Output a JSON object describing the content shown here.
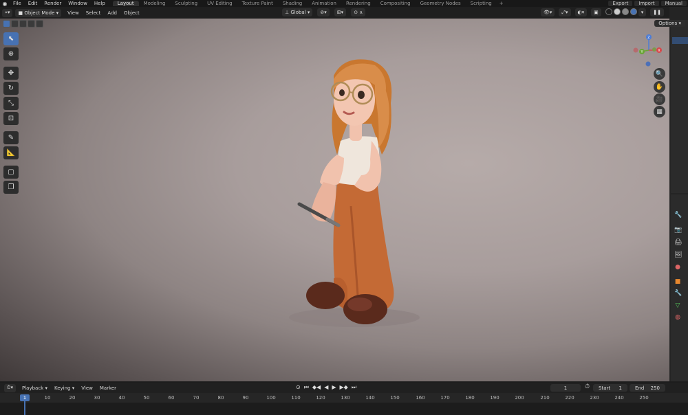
{
  "menubar": {
    "items": [
      "File",
      "Edit",
      "Render",
      "Window",
      "Help"
    ],
    "workspaces": [
      "Layout",
      "Modeling",
      "Sculpting",
      "UV Editing",
      "Texture Paint",
      "Shading",
      "Animation",
      "Rendering",
      "Compositing",
      "Geometry Nodes",
      "Scripting"
    ],
    "active_workspace": "Layout",
    "add_tab": "+",
    "export_label": "Export",
    "import_label": "Import",
    "manual_label": "Manual"
  },
  "viewport_header": {
    "mode_label": "Object Mode",
    "menus": [
      "View",
      "Select",
      "Add",
      "Object"
    ],
    "transform_orientation": "Global",
    "options_label": "Options"
  },
  "gizmo": {
    "z": "Z",
    "y": "Y",
    "x": "X"
  },
  "timeline": {
    "menus": [
      "Playback",
      "Keying",
      "View",
      "Marker"
    ],
    "current_frame": "1",
    "start_label": "Start",
    "start_value": "1",
    "end_label": "End",
    "end_value": "250",
    "ruler_current": "1",
    "ticks": [
      "10",
      "20",
      "30",
      "40",
      "50",
      "60",
      "70",
      "80",
      "90",
      "100",
      "110",
      "120",
      "130",
      "140",
      "150",
      "160",
      "170",
      "180",
      "190",
      "200",
      "210",
      "220",
      "230",
      "240",
      "250"
    ]
  },
  "colors": {
    "accent": "#4772b3",
    "header": "#1f1f1f",
    "panel": "#2b2b2b",
    "hair": "#d98d4a",
    "pants": "#c46a35",
    "shoes": "#5a2a1c",
    "skin": "#f1c2ad"
  }
}
